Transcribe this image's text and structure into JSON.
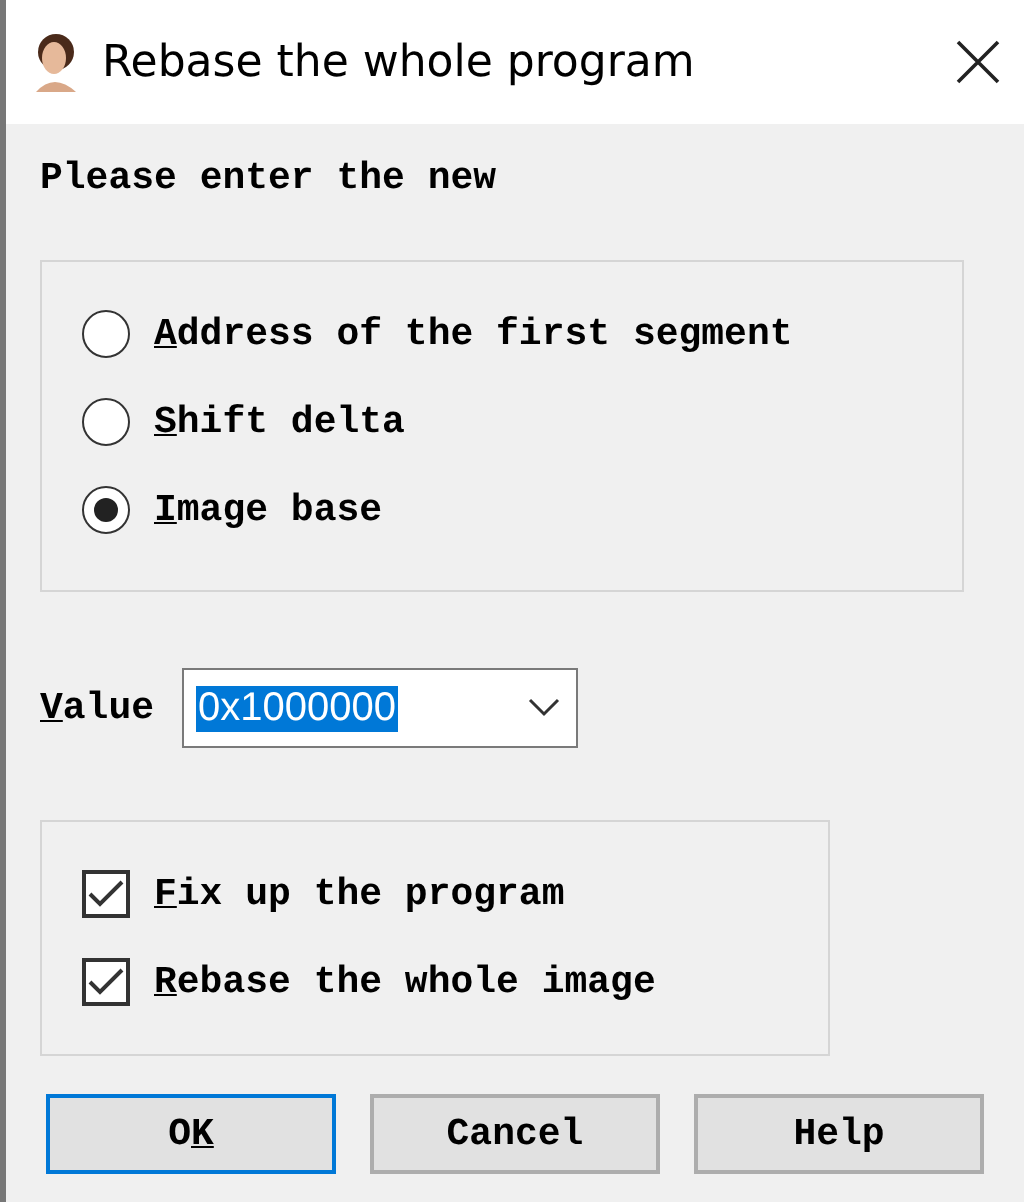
{
  "window": {
    "title": "Rebase the whole program"
  },
  "prompt": "Please enter the new",
  "options": [
    {
      "key": "A",
      "post": "ddress of the first segment",
      "selected": false
    },
    {
      "key": "S",
      "post": "hift delta",
      "selected": false
    },
    {
      "key": "I",
      "post": "mage base",
      "selected": true
    }
  ],
  "value": {
    "label": {
      "key": "V",
      "post": "alue"
    },
    "text": "0x1000000"
  },
  "checks": [
    {
      "key": "F",
      "post": "ix up the program",
      "checked": true
    },
    {
      "key": "R",
      "post": "ebase the whole image",
      "checked": true
    }
  ],
  "buttons": [
    {
      "pre": "O",
      "key": "K",
      "default": true
    },
    {
      "pre": "Cancel",
      "default": false
    },
    {
      "pre": "Help",
      "default": false
    }
  ]
}
